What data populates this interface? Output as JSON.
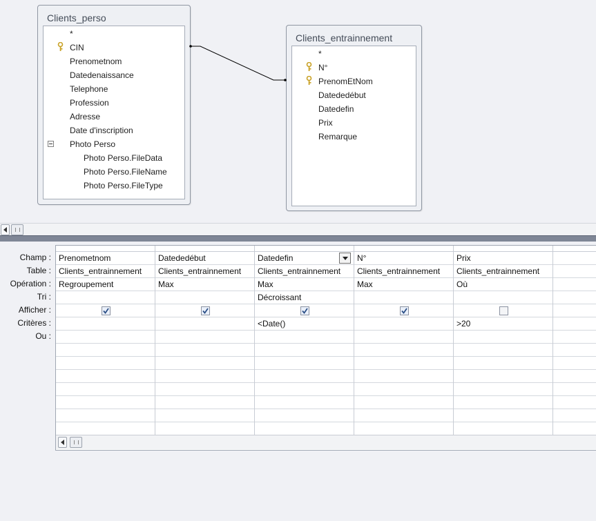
{
  "tables": [
    {
      "title": "Clients_perso",
      "fields": [
        {
          "label": "*",
          "key": false
        },
        {
          "label": "CIN",
          "key": true
        },
        {
          "label": "Prenometnom",
          "key": false
        },
        {
          "label": "Datedenaissance",
          "key": false
        },
        {
          "label": "Telephone",
          "key": false
        },
        {
          "label": "Profession",
          "key": false
        },
        {
          "label": "Adresse",
          "key": false
        },
        {
          "label": "Date d'inscription",
          "key": false
        },
        {
          "label": "Photo Perso",
          "key": false,
          "expanded": true
        },
        {
          "label": "Photo Perso.FileData",
          "key": false,
          "child": true
        },
        {
          "label": "Photo Perso.FileName",
          "key": false,
          "child": true
        },
        {
          "label": "Photo Perso.FileType",
          "key": false,
          "child": true
        }
      ]
    },
    {
      "title": "Clients_entrainnement",
      "fields": [
        {
          "label": "*",
          "key": false
        },
        {
          "label": "N°",
          "key": true
        },
        {
          "label": "PrenomEtNom",
          "key": true
        },
        {
          "label": "Datededébut",
          "key": false
        },
        {
          "label": "Datedefin",
          "key": false
        },
        {
          "label": "Prix",
          "key": false
        },
        {
          "label": "Remarque",
          "key": false
        }
      ]
    }
  ],
  "row_labels": [
    "Champ :",
    "Table :",
    "Opération :",
    "Tri :",
    "Afficher :",
    "Critères :",
    "Ou :"
  ],
  "columns": [
    {
      "champ": "Prenometnom",
      "table": "Clients_entrainnement",
      "operation": "Regroupement",
      "tri": "",
      "afficher": true,
      "criteres": "",
      "ou": ""
    },
    {
      "champ": "Datededébut",
      "table": "Clients_entrainnement",
      "operation": "Max",
      "tri": "",
      "afficher": true,
      "criteres": "",
      "ou": ""
    },
    {
      "champ": "Datedefin",
      "table": "Clients_entrainnement",
      "operation": "Max",
      "tri": "Décroissant",
      "afficher": true,
      "criteres": "<Date()",
      "ou": "",
      "active": true
    },
    {
      "champ": "N°",
      "table": "Clients_entrainnement",
      "operation": "Max",
      "tri": "",
      "afficher": true,
      "criteres": "",
      "ou": ""
    },
    {
      "champ": "Prix",
      "table": "Clients_entrainnement",
      "operation": "Où",
      "tri": "",
      "afficher": false,
      "criteres": ">20",
      "ou": ""
    },
    {
      "champ": "",
      "table": "",
      "operation": "",
      "tri": "",
      "afficher": null,
      "criteres": "",
      "ou": ""
    }
  ],
  "icons": {
    "key": "primary-key-icon",
    "expand": "collapse-minus-icon",
    "scroll_left": "scroll-left-arrow-icon",
    "dropdown": "dropdown-arrow-icon",
    "checkbox": "checkbox-check-icon"
  },
  "colors": {
    "key_gold": "#c9a227",
    "check_blue": "#2b4f86",
    "join_line": "#000000"
  }
}
